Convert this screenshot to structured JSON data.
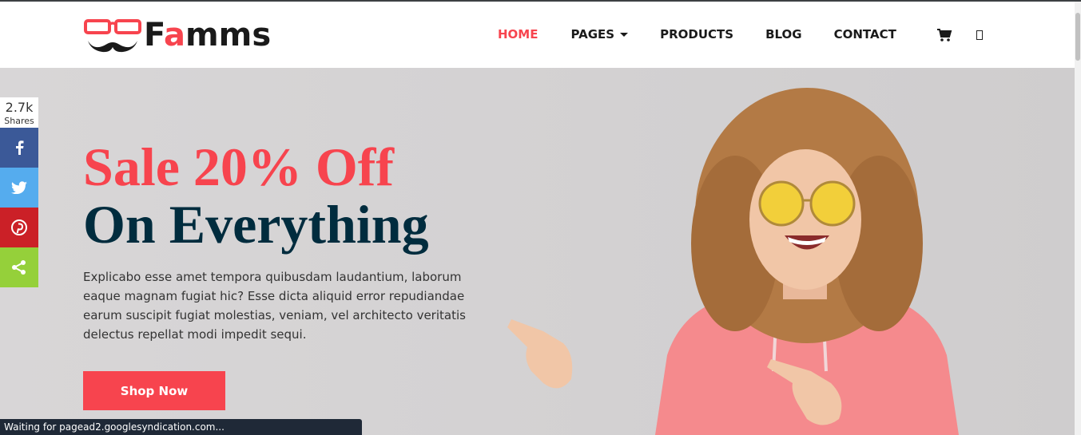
{
  "brand": {
    "name_pre": "F",
    "name_accent": "a",
    "name_post": "mms"
  },
  "nav": {
    "items": [
      {
        "label": "HOME",
        "active": true
      },
      {
        "label": "PAGES",
        "dropdown": true
      },
      {
        "label": "PRODUCTS"
      },
      {
        "label": "BLOG"
      },
      {
        "label": "CONTACT"
      }
    ],
    "cart_icon": "cart-icon",
    "search_icon": "search-icon"
  },
  "share": {
    "count": "2.7k",
    "label": "Shares",
    "buttons": [
      {
        "icon": "facebook-icon",
        "color": "#3b5998"
      },
      {
        "icon": "twitter-icon",
        "color": "#55acee"
      },
      {
        "icon": "pinterest-icon",
        "color": "#cb2027"
      },
      {
        "icon": "share-icon",
        "color": "#95d03a"
      }
    ]
  },
  "hero": {
    "title_line1": "Sale 20% Off",
    "title_line2": "On Everything",
    "description": "Explicabo esse amet tempora quibusdam laudantium, laborum eaque magnam fugiat hic? Esse dicta aliquid error repudiandae earum suscipit fugiat molestias, veniam, vel architecto veritatis delectus repellat modi impedit sequi.",
    "button_label": "Shop Now"
  },
  "status_bar": {
    "text": "Waiting for pagead2.googlesyndication.com..."
  },
  "colors": {
    "accent": "#f7444e",
    "dark": "#002c3e"
  }
}
